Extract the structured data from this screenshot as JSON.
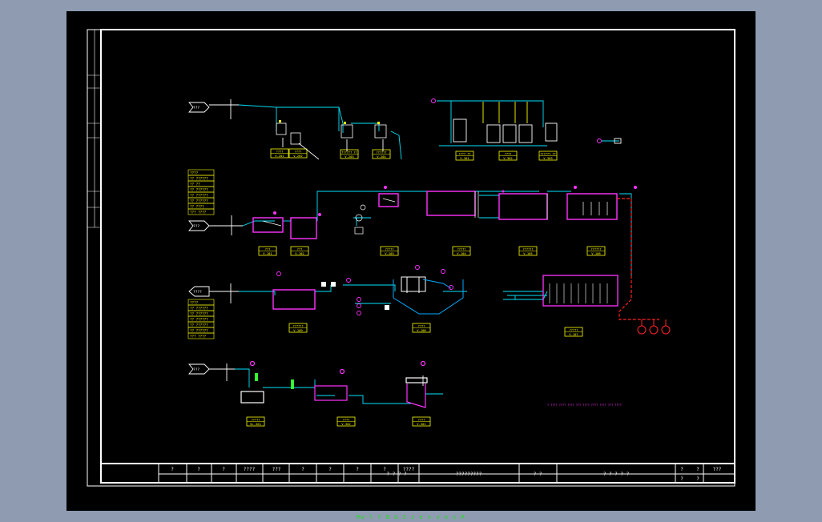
{
  "title_block": {
    "header_cells": [
      "?",
      "?",
      "?",
      "????",
      "???",
      "?",
      "?",
      "?",
      "?",
      "????"
    ],
    "left_code": "? ? ? ?",
    "drawing_name": "?????????",
    "right_label": "? ?",
    "subject": "? ? ? ? ?",
    "sheet_cells": [
      "?",
      "?",
      "???",
      "?",
      "?"
    ]
  },
  "tags": {
    "r1": [
      {
        "line1": "????",
        "line2": "V-201"
      },
      {
        "line1": "????",
        "line2": "V-202"
      },
      {
        "line1": "?????? ??",
        "line2": "V-203"
      },
      {
        "line1": "??????",
        "line2": "V-204"
      },
      {
        "line1": "???? ??",
        "line2": "V-301"
      },
      {
        "line1": "????",
        "line2": "V-302"
      },
      {
        "line1": "?????? ??",
        "line2": "V-303"
      }
    ],
    "r2": [
      {
        "line1": "???",
        "line2": "V-101"
      },
      {
        "line1": "???",
        "line2": "V-102"
      },
      {
        "line1": "?????",
        "line2": "V-103"
      },
      {
        "line1": "?????",
        "line2": "V-104"
      },
      {
        "line1": "??????",
        "line2": "V-105"
      },
      {
        "line1": "??????",
        "line2": "V-106"
      }
    ],
    "r3": [
      {
        "line1": "??????",
        "line2": "V-109"
      },
      {
        "line1": "????",
        "line2": "V-108"
      },
      {
        "line1": "?????",
        "line2": "V-107"
      }
    ],
    "r4": [
      {
        "line1": "?????",
        "line2": "SL-301"
      },
      {
        "line1": "????",
        "line2": "V-302"
      },
      {
        "line1": "????",
        "line2": "V-301"
      }
    ]
  },
  "legend_a": [
    "????",
    "?? ??????",
    "?? ??",
    "?? ??????",
    "?? ??????",
    "?? ??????",
    "?? ????",
    "??? ????"
  ],
  "legend_b": [
    "????",
    "?? ??????",
    "?? ??????",
    "?? ??????",
    "?? ??????",
    "?? ??????",
    "??? ????"
  ],
  "arrows": {
    "in1": "???",
    "in2": "???",
    "out1": "????",
    "in3": "???"
  },
  "note": "? ???? ???? ???? ??? ???? ???? ???? ??? ????",
  "caption": "Mw-l Y B & S  z e x  u a y R"
}
